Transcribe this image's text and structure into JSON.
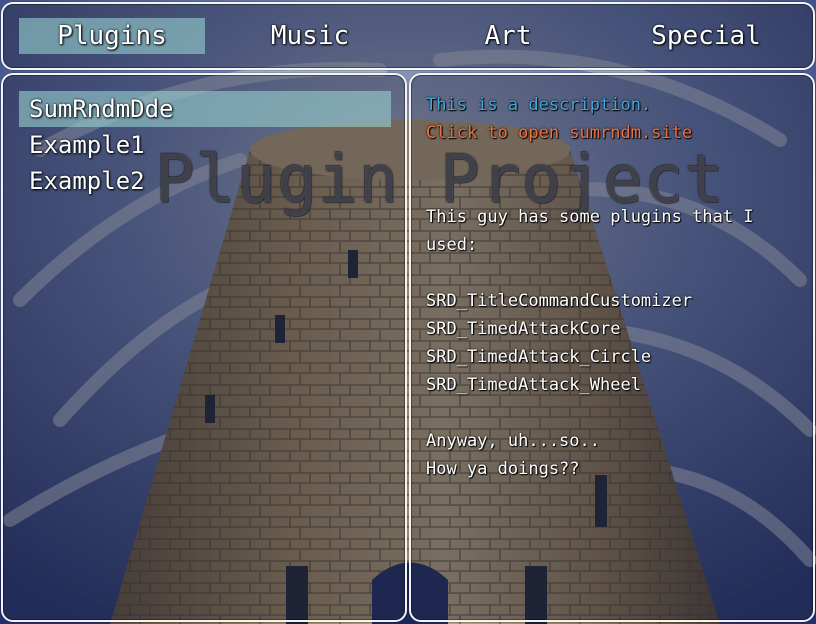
{
  "title": "Plugin Project",
  "tabs": [
    {
      "label": "Plugins",
      "selected": true
    },
    {
      "label": "Music",
      "selected": false
    },
    {
      "label": "Art",
      "selected": false
    },
    {
      "label": "Special",
      "selected": false
    }
  ],
  "list": {
    "items": [
      {
        "label": "SumRndmDde",
        "selected": true
      },
      {
        "label": "Example1",
        "selected": false
      },
      {
        "label": "Example2",
        "selected": false
      }
    ]
  },
  "help": {
    "description": "This is a description.",
    "description_color": "#3fa9dc",
    "link": "Click to open sumrndm.site",
    "link_color": "#f0703c",
    "body": [
      "This guy has some plugins that I",
      "used:",
      "SRD_TitleCommandCustomizer",
      "SRD_TimedAttackCore",
      "SRD_TimedAttack_Circle",
      "SRD_TimedAttack_Wheel",
      "Anyway, uh...so..",
      "How ya doings??"
    ]
  },
  "colors": {
    "window_border": "#f4f4f4",
    "selection": "#96cdcd",
    "sky": "#2a3d7a",
    "tower": "#b0925c"
  },
  "background_image": "tower-under-swirling-sky"
}
